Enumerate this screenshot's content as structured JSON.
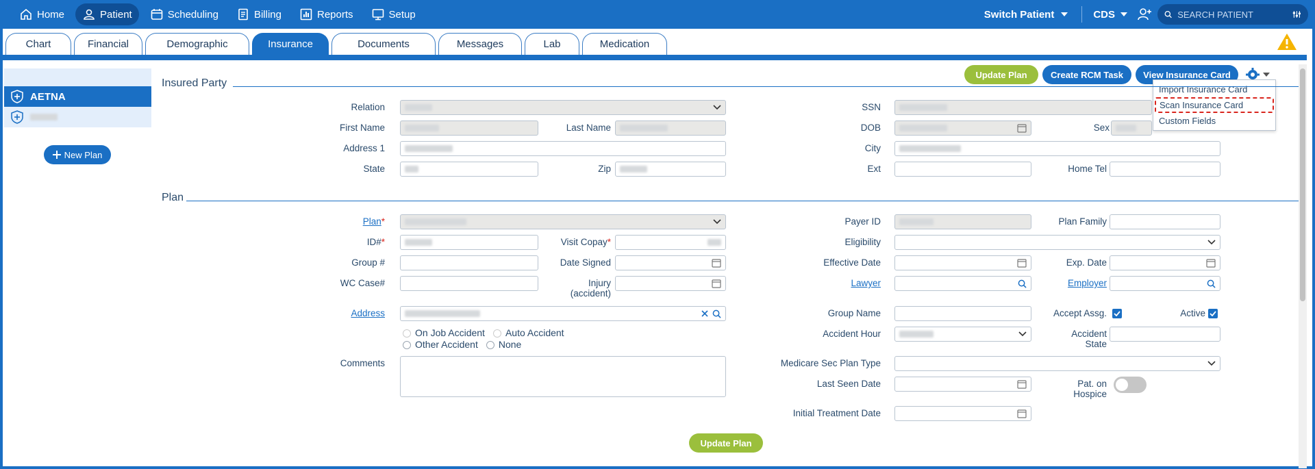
{
  "nav": {
    "items": [
      {
        "label": "Home",
        "icon": "home-icon"
      },
      {
        "label": "Patient",
        "icon": "user-icon"
      },
      {
        "label": "Scheduling",
        "icon": "calendar-icon"
      },
      {
        "label": "Billing",
        "icon": "billing-icon"
      },
      {
        "label": "Reports",
        "icon": "reports-icon"
      },
      {
        "label": "Setup",
        "icon": "setup-icon"
      }
    ],
    "switch_patient": "Switch Patient",
    "cds": "CDS",
    "search_placeholder": "SEARCH PATIENT"
  },
  "tabs": [
    "Chart",
    "Financial",
    "Demographic",
    "Insurance",
    "Documents",
    "Messages",
    "Lab",
    "Medication"
  ],
  "sidebar": {
    "plans": [
      {
        "label": "AETNA"
      }
    ],
    "new_plan": "New Plan"
  },
  "actions": {
    "update_plan": "Update Plan",
    "create_rcm_task": "Create RCM Task",
    "view_insurance_card": "View Insurance Card"
  },
  "menu": {
    "items": [
      "Import Insurance Card",
      "Scan Insurance Card",
      "Custom Fields"
    ]
  },
  "insured": {
    "title": "Insured Party",
    "relation": "Relation",
    "first_name": "First Name",
    "last_name": "Last Name",
    "address1": "Address 1",
    "state": "State",
    "zip": "Zip",
    "ssn": "SSN",
    "dob": "DOB",
    "sex": "Sex",
    "city": "City",
    "ext": "Ext",
    "home_tel": "Home Tel"
  },
  "plan": {
    "title": "Plan",
    "plan": "Plan",
    "id": "ID#",
    "group": "Group #",
    "wc_case": "WC Case#",
    "address": "Address",
    "visit_copay": "Visit Copay",
    "date_signed": "Date Signed",
    "injury": "Injury",
    "injury_sub": "(accident)",
    "radios": [
      "On Job Accident",
      "Auto Accident",
      "Other Accident",
      "None"
    ],
    "comments": "Comments",
    "payer_id": "Payer ID",
    "plan_family": "Plan Family",
    "eligibility": "Eligibility",
    "effective_date": "Effective Date",
    "exp_date": "Exp. Date",
    "lawyer": "Lawyer",
    "employer": "Employer",
    "group_name": "Group Name",
    "accept_assg": "Accept Assg.",
    "active": "Active",
    "accident_hour": "Accident Hour",
    "accident_state_1": "Accident",
    "accident_state_2": "State",
    "medicare_sec": "Medicare Sec Plan Type",
    "last_seen": "Last Seen Date",
    "hospice_1": "Pat. on",
    "hospice_2": "Hospice",
    "initial_treatment": "Initial Treatment Date",
    "update_plan": "Update Plan"
  }
}
